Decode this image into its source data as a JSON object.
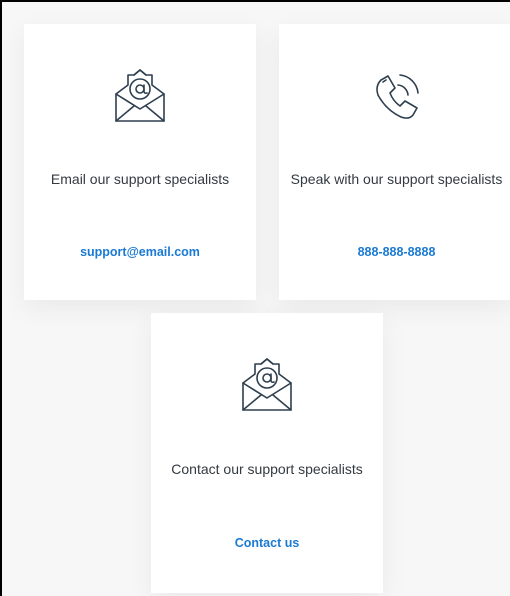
{
  "cards": [
    {
      "icon": "envelope-at-icon",
      "description": "Email our support specialists",
      "link_text": "support@email.com"
    },
    {
      "icon": "phone-ringing-icon",
      "description": "Speak with our support specialists",
      "link_text": "888-888-8888"
    },
    {
      "icon": "envelope-at-icon",
      "description": "Contact our support specialists",
      "link_text": "Contact us"
    }
  ],
  "colors": {
    "link": "#1a7ad4",
    "text": "#333a40",
    "icon_stroke": "#2e3f4f",
    "card_background": "#ffffff",
    "page_background": "#f7f7f7"
  }
}
